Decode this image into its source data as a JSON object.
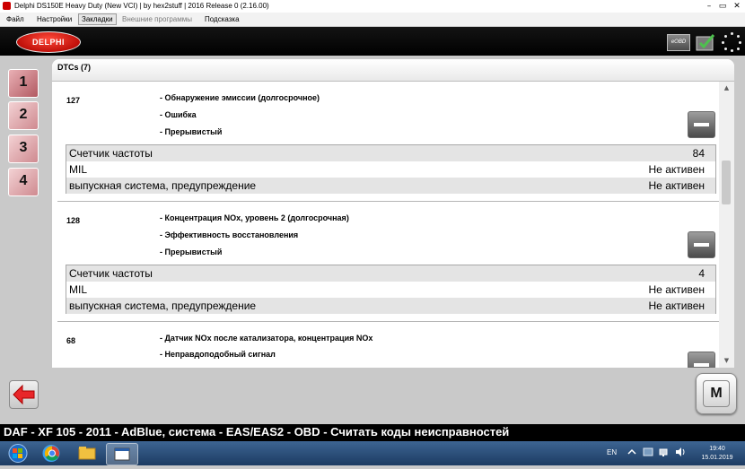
{
  "window": {
    "title": "Delphi DS150E Heavy Duty (New VCI) | by hex2stuff | 2016 Release 0 (2.16.00)"
  },
  "menu": [
    "Файл",
    "Настройки",
    "Закладки",
    "Внешние программы",
    "Подсказка"
  ],
  "header": {
    "logo_text": "DELPHI",
    "eobd_label": "eOBD"
  },
  "nav": {
    "buttons": [
      "1",
      "2",
      "3",
      "4"
    ],
    "selected": "1"
  },
  "panel": {
    "title": "DTCs (7)",
    "dtcs": [
      {
        "code": "127",
        "lines": [
          "- Обнаружение эмиссии (долгосрочное)",
          "- Ошибка",
          "- Прерывистый"
        ],
        "rows": [
          {
            "key": "Счетчик частоты",
            "value": "84"
          },
          {
            "key": "MIL",
            "value": "Не активен"
          },
          {
            "key": "выпускная система, предупреждение",
            "value": "Не активен"
          }
        ]
      },
      {
        "code": "128",
        "lines": [
          "- Концентрация NOx, уровень 2 (долгосрочная)",
          "- Эффективность восстановления",
          "- Прерывистый"
        ],
        "rows": [
          {
            "key": "Счетчик частоты",
            "value": "4"
          },
          {
            "key": "MIL",
            "value": "Не активен"
          },
          {
            "key": "выпускная система, предупреждение",
            "value": "Не активен"
          }
        ]
      },
      {
        "code": "68",
        "lines": [
          "- Датчик NOx после катализатора, концентрация NOx",
          "- Неправдоподобный сигнал"
        ],
        "rows": []
      }
    ]
  },
  "mode_button": "M",
  "status": "DAF - XF 105 - 2011 - AdBlue, система - EAS/EAS2 - OBD - Считать коды неисправностей",
  "taskbar": {
    "language": "EN",
    "time": "19:40",
    "date": "15.01.2019"
  },
  "colors": {
    "accent_red": "#c0100a",
    "nav_pink": "#cf8a90",
    "status_bg": "#000000"
  }
}
